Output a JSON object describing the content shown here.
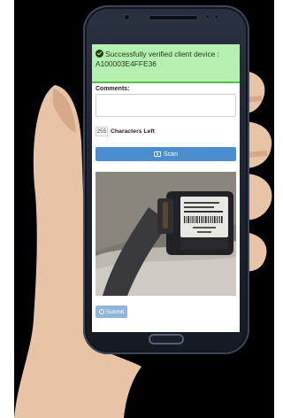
{
  "alert": {
    "message": "Successfully verified client device :",
    "device_id": "A100003E4FFE36",
    "icon": "check-circle-icon"
  },
  "form": {
    "comments_label": "Comments:",
    "comments_value": "",
    "chars_remaining": "255",
    "chars_left_label": "Characters Left",
    "scan_label": "Scan",
    "submit_label": "Submit"
  },
  "colors": {
    "success_bg": "#b6f0b0",
    "success_border": "#4cc24c",
    "scan_button": "#4a8ed0",
    "submit_button_disabled": "#8fb6d8"
  }
}
